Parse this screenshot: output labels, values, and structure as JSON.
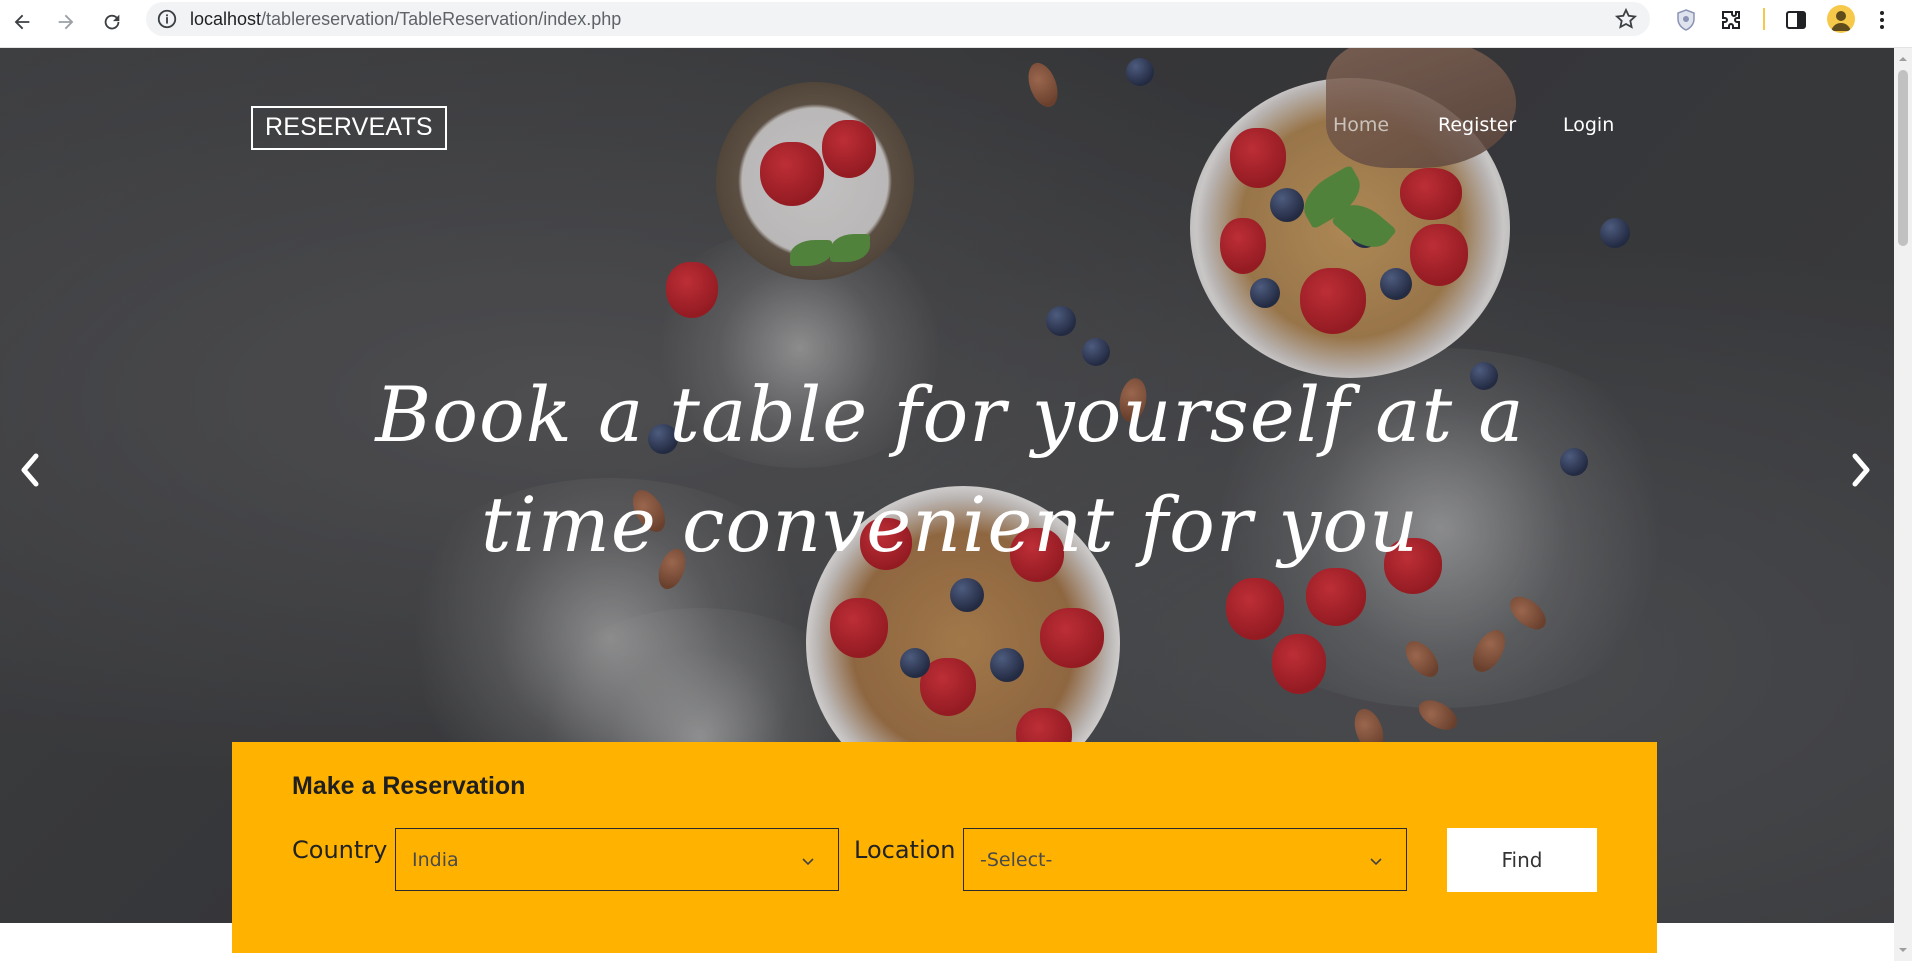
{
  "browser": {
    "url_host": "localhost",
    "url_path": "/tablereservation/TableReservation/index.php",
    "icons": [
      "back-icon",
      "forward-icon",
      "reload-icon",
      "site-info-icon",
      "bookmark-star-icon",
      "shield-extension-icon",
      "extensions-puzzle-icon",
      "side-panel-icon",
      "profile-icon",
      "menu-kebab-icon"
    ]
  },
  "site": {
    "brand": "RESERVEATS",
    "nav": [
      {
        "label": "Home",
        "active": true
      },
      {
        "label": "Register",
        "active": false
      },
      {
        "label": "Login",
        "active": false
      }
    ],
    "headline": "Book a table for yourself at a time convenient for you"
  },
  "reservation": {
    "title": "Make a Reservation",
    "country_label": "Country",
    "country_value": "India",
    "location_label": "Location",
    "location_value": "-Select-",
    "find_label": "Find"
  },
  "colors": {
    "accent": "#ffb300",
    "text_dark": "#1f1f1f"
  }
}
